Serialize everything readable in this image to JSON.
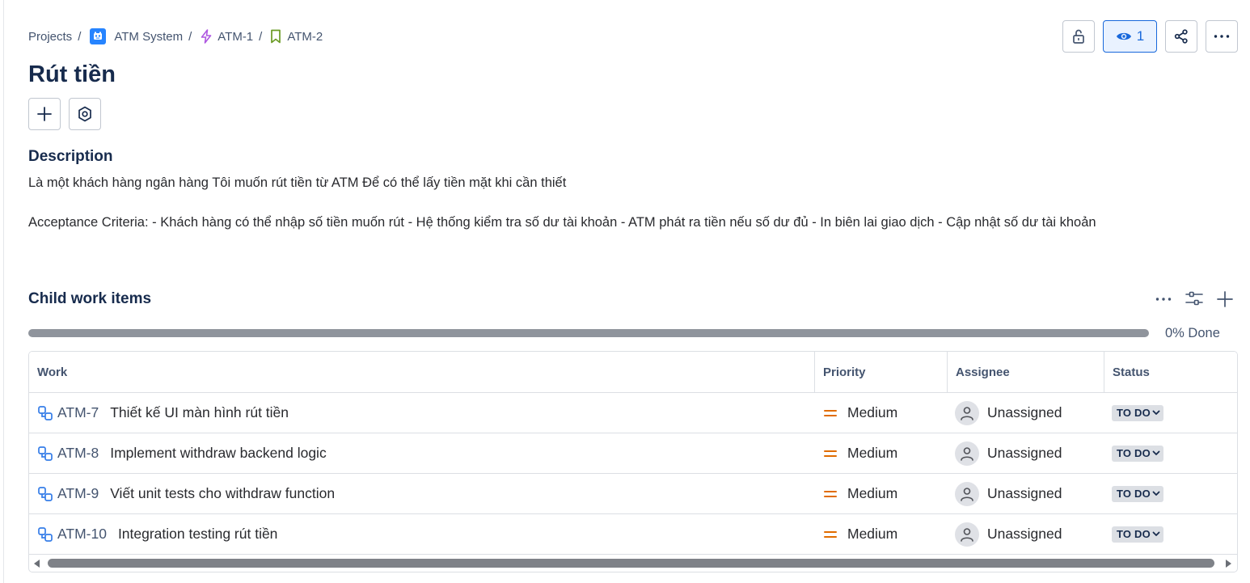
{
  "breadcrumb": {
    "projects": "Projects",
    "separator": "/",
    "project": "ATM System",
    "epic": "ATM-1",
    "story": "ATM-2"
  },
  "header": {
    "watch_count": "1",
    "icons": [
      "lock-open-icon",
      "eye-icon",
      "share-icon",
      "more-icon"
    ]
  },
  "issue": {
    "title": "Rút tiền",
    "action_icons": [
      "plus-icon",
      "settings-icon"
    ]
  },
  "description": {
    "heading": "Description",
    "paragraph1": "Là một khách hàng ngân hàng Tôi muốn rút tiền từ ATM Để có thể lấy tiền mặt khi cần thiết",
    "paragraph2": "Acceptance Criteria: - Khách hàng có thể nhập số tiền muốn rút - Hệ thống kiểm tra số dư tài khoản - ATM phát ra tiền nếu số dư đủ - In biên lai giao dịch - Cập nhật số dư tài khoản"
  },
  "child_items": {
    "heading": "Child work items",
    "progress_percent": 0,
    "progress_label": "0% Done",
    "columns": [
      "Work",
      "Priority",
      "Assignee",
      "Status"
    ],
    "rows": [
      {
        "key": "ATM-7",
        "summary": "Thiết kế UI màn hình rút tiền",
        "priority": "Medium",
        "assignee": "Unassigned",
        "status": "TO DO"
      },
      {
        "key": "ATM-8",
        "summary": "Implement withdraw backend logic",
        "priority": "Medium",
        "assignee": "Unassigned",
        "status": "TO DO"
      },
      {
        "key": "ATM-9",
        "summary": "Viết unit tests cho withdraw function",
        "priority": "Medium",
        "assignee": "Unassigned",
        "status": "TO DO"
      },
      {
        "key": "ATM-10",
        "summary": "Integration testing rút tiền",
        "priority": "Medium",
        "assignee": "Unassigned",
        "status": "TO DO"
      }
    ]
  },
  "colors": {
    "accent": "#1868db",
    "priority_medium": "#e06c00",
    "epic": "#af59e1",
    "story": "#6a9a23",
    "subtask": "#357de8"
  }
}
